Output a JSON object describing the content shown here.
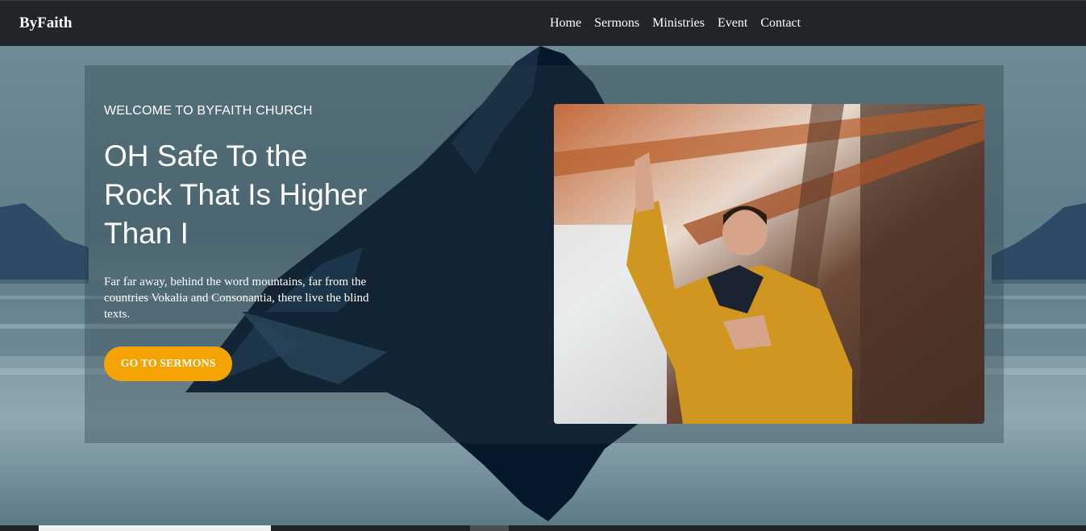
{
  "navbar": {
    "brand": "ByFaith",
    "links": [
      "Home",
      "Sermons",
      "Ministries",
      "Event",
      "Contact"
    ]
  },
  "hero": {
    "eyebrow": "WELCOME TO BYFAITH CHURCH",
    "headline": "OH Safe To the Rock That Is Higher Than I",
    "description": "Far far away, behind the word mountains, far from the countries Vokalia and Consonantia, there live the blind texts.",
    "cta_label": "GO TO SERMONS",
    "photo": "man-praying-in-yellow-jacket"
  },
  "colors": {
    "navbar_bg": "#212429",
    "accent": "#f5a300",
    "mountain": "#07182a"
  }
}
